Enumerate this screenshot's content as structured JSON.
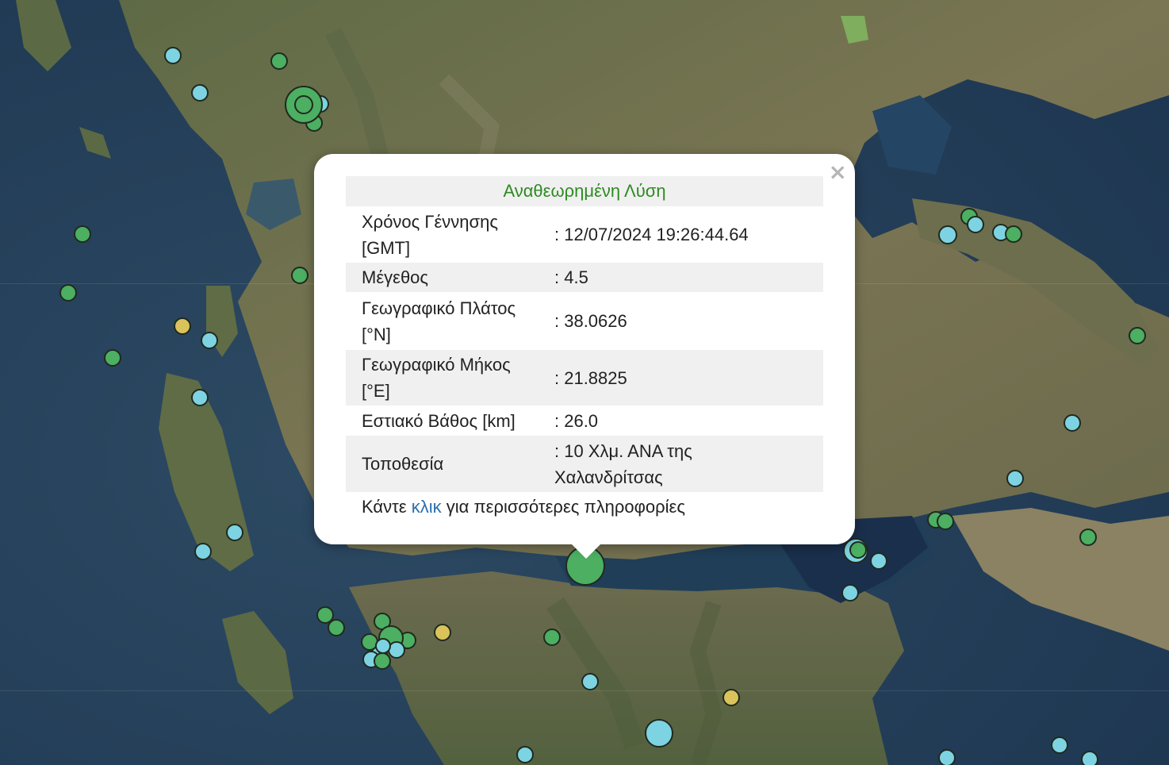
{
  "popup": {
    "title": "Αναθεωρημένη Λύση",
    "close_symbol": "×",
    "rows": [
      {
        "label_l1": "Χρόνος Γέννησης",
        "label_l2": "[GMT]",
        "value_l1": ": 12/07/2024 19:26:44.64",
        "value_l2": ""
      },
      {
        "label_l1": "Μέγεθος",
        "label_l2": "",
        "value_l1": ": 4.5",
        "value_l2": ""
      },
      {
        "label_l1": "Γεωγραφικό Πλάτος",
        "label_l2": "[°N]",
        "value_l1": ": 38.0626",
        "value_l2": ""
      },
      {
        "label_l1": "Γεωγραφικό Μήκος",
        "label_l2": "[°E]",
        "value_l1": ": 21.8825",
        "value_l2": ""
      },
      {
        "label_l1": "Εστιακό Βάθος [km]",
        "label_l2": "",
        "value_l1": ": 26.0",
        "value_l2": ""
      },
      {
        "label_l1": "Τοποθεσία",
        "label_l2": "",
        "value_l1": ": 10 Χλμ. ΑΝΑ της",
        "value_l2": "Χαλανδρίτσας"
      }
    ],
    "footer_before": "Κάντε ",
    "footer_link": "κλικ",
    "footer_after": " για περισσότερες πληροφορίες"
  },
  "colors": {
    "green_marker": "#4caf62",
    "cyan_marker": "#7ed3e3",
    "yellow_marker": "#d9c35a",
    "title_green": "#2e8b22",
    "link_blue": "#2a6fb0"
  },
  "map": {
    "layer": "satellite",
    "marker_colors": [
      "green",
      "cyan",
      "yellow"
    ]
  }
}
